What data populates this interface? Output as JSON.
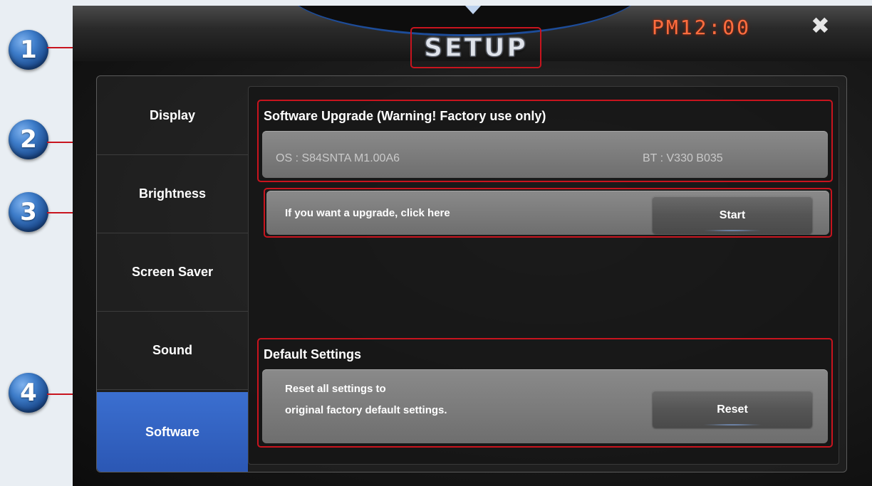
{
  "header": {
    "title": "SETUP",
    "clock": "PM12:00",
    "close_icon": "close-icon"
  },
  "callouts": [
    "1",
    "2",
    "3",
    "4"
  ],
  "sidebar": {
    "items": [
      {
        "label": "Display",
        "active": false
      },
      {
        "label": "Brightness",
        "active": false
      },
      {
        "label": "Screen Saver",
        "active": false
      },
      {
        "label": "Sound",
        "active": false
      },
      {
        "label": "Software",
        "active": true
      }
    ]
  },
  "software_upgrade": {
    "title": "Software Upgrade (Warning! Factory use only)",
    "os_version": "OS : S84SNTA M1.00A6",
    "bt_version": "BT : V330 B035",
    "prompt": "If you want a upgrade, click here",
    "start_label": "Start"
  },
  "default_settings": {
    "title": "Default Settings",
    "line1": "Reset all settings to",
    "line2": "original factory default settings.",
    "reset_label": "Reset"
  },
  "colors": {
    "highlight": "#c8141e",
    "active_tab": "#2b57b4",
    "clock": "#ff6d3f"
  }
}
